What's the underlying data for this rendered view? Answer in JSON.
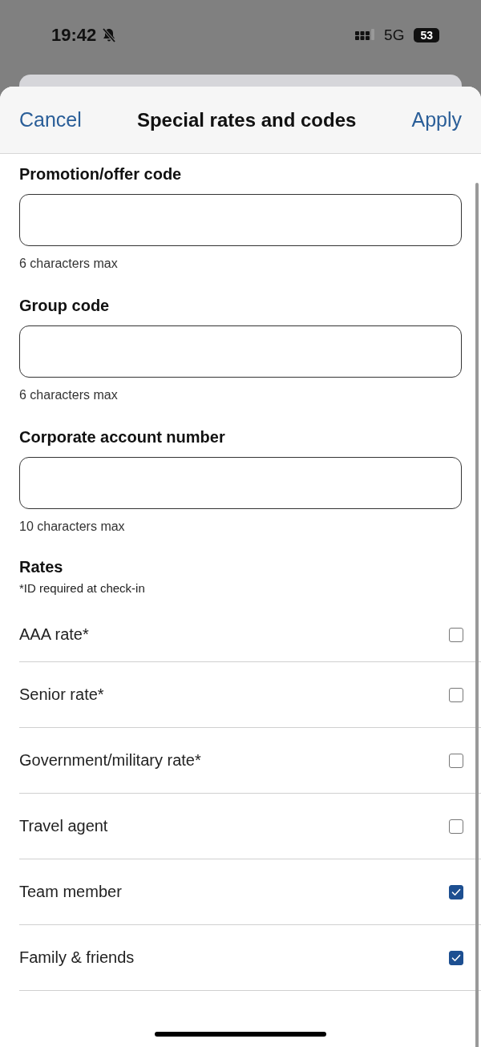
{
  "status_bar": {
    "time": "19:42",
    "network": "5G",
    "battery": "53"
  },
  "header": {
    "cancel": "Cancel",
    "title": "Special rates and codes",
    "apply": "Apply"
  },
  "fields": [
    {
      "label": "Promotion/offer code",
      "hint": "6 characters max"
    },
    {
      "label": "Group code",
      "hint": "6 characters max"
    },
    {
      "label": "Corporate account number",
      "hint": "10 characters max"
    }
  ],
  "rates": {
    "title": "Rates",
    "note": "*ID required at check-in",
    "items": [
      {
        "label": "AAA rate*",
        "checked": false
      },
      {
        "label": "Senior rate*",
        "checked": false
      },
      {
        "label": "Government/military rate*",
        "checked": false
      },
      {
        "label": "Travel agent",
        "checked": false
      },
      {
        "label": "Team member",
        "checked": true
      },
      {
        "label": "Family & friends",
        "checked": true
      }
    ]
  }
}
